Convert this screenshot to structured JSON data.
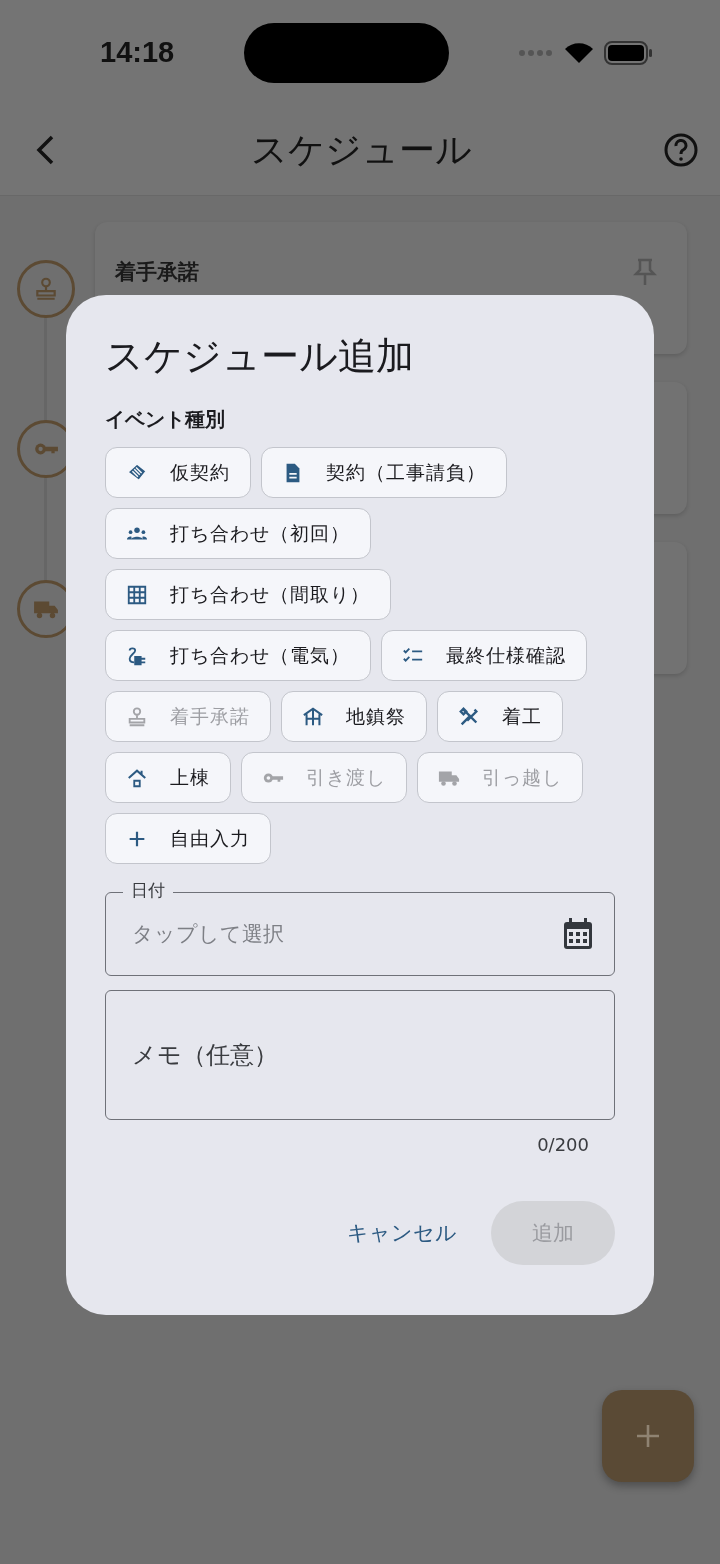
{
  "status_bar": {
    "time": "14:18"
  },
  "header": {
    "title": "スケジュール"
  },
  "timeline": [
    {
      "title": "着手承諾",
      "pinned": true
    },
    {
      "pinned": false
    },
    {
      "pinned": false
    }
  ],
  "dialog": {
    "title": "スケジュール追加",
    "section_label": "イベント種別",
    "chips": [
      {
        "label": "仮契約",
        "disabled": false
      },
      {
        "label": "契約（工事請負）",
        "disabled": false
      },
      {
        "label": "打ち合わせ（初回）",
        "disabled": false
      },
      {
        "label": "打ち合わせ（間取り）",
        "disabled": false
      },
      {
        "label": "打ち合わせ（電気）",
        "disabled": false
      },
      {
        "label": "最終仕様確認",
        "disabled": false
      },
      {
        "label": "着手承諾",
        "disabled": true
      },
      {
        "label": "地鎮祭",
        "disabled": false
      },
      {
        "label": "着工",
        "disabled": false
      },
      {
        "label": "上棟",
        "disabled": false
      },
      {
        "label": "引き渡し",
        "disabled": true
      },
      {
        "label": "引っ越し",
        "disabled": true
      },
      {
        "label": "自由入力",
        "disabled": false
      }
    ],
    "date_field": {
      "label": "日付",
      "placeholder": "タップして選択"
    },
    "memo_field": {
      "placeholder": "メモ（任意）",
      "counter": "0/200"
    },
    "buttons": [
      {
        "label": "キャンセル",
        "disabled": false
      },
      {
        "label": "追加",
        "disabled": true
      }
    ]
  }
}
